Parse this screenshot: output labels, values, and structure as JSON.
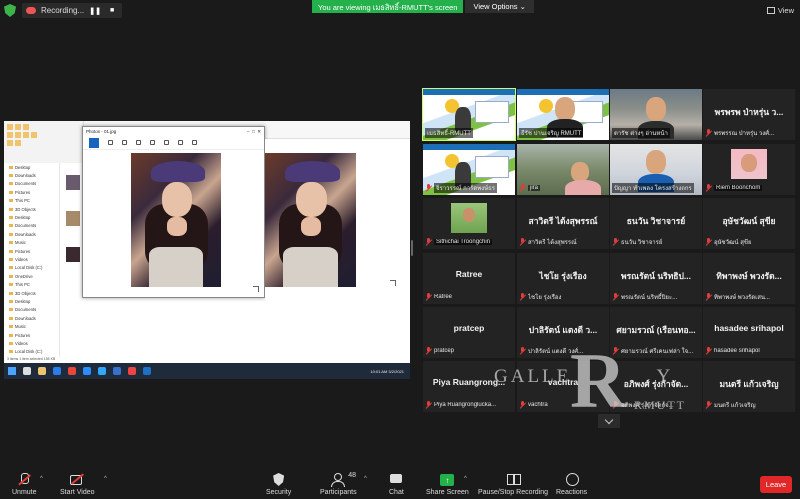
{
  "top": {
    "recording_label": "Recording...",
    "viewing_banner": "You are viewing เมธสิทธิ์-RMUTT's screen",
    "view_options": "View Options",
    "view_label": "View"
  },
  "shared_screen": {
    "photos_title": "Photos - 01.jpg",
    "tree_items": [
      "Desktop",
      "Downloads",
      "Documents",
      "Pictures",
      "This PC",
      "3D Objects",
      "Desktop",
      "Documents",
      "Downloads",
      "Music",
      "Pictures",
      "Videos",
      "Local Disk (C:)",
      "OneDrive",
      "This PC",
      "3D Objects",
      "Desktop",
      "Documents",
      "Downloads",
      "Music",
      "Pictures",
      "Videos",
      "Local Disk (C:)",
      "Local Disk (D:)"
    ],
    "status_text": "3 items   1 item selected  155 KB",
    "clock": "10:01 AM 3/2/2021"
  },
  "gallery": {
    "participants": [
      {
        "name": "เมธสิทธิ์-RMUTT",
        "big": "",
        "video": "poster",
        "speaking": true,
        "muted": false
      },
      {
        "name": "ธีรัช ปานเจริญ RMUTT",
        "big": "",
        "video": "poster-person",
        "muted": false
      },
      {
        "name": "ดารัช ต่างๆ อ่านหน้า",
        "big": "",
        "video": "room-person",
        "muted": false
      },
      {
        "name": "พรพรรณ ป่าหรุ่น วงศ์...",
        "big": "พรพรพ ป่าหรุ่น ว...",
        "video": "none",
        "muted": true
      },
      {
        "name": "จิราวรรณ์ การ์ดพงษ์ธร",
        "big": "",
        "video": "poster",
        "muted": true
      },
      {
        "name": "jira",
        "big": "",
        "video": "room2",
        "muted": true
      },
      {
        "name": "ปัญญา ทำเพลง โครงสร้างถกร",
        "big": "",
        "video": "room3",
        "muted": false
      },
      {
        "name": "Riem Boonchom",
        "big": "",
        "video": "thumb-pink",
        "muted": true
      },
      {
        "name": "Sithichai Troongchin",
        "big": "",
        "video": "thumb-green",
        "muted": true
      },
      {
        "name": "สาวิตรี ได้งสุพรรณ์",
        "big": "สาวิตรี ได้งสุพรรณ์",
        "video": "none",
        "muted": true
      },
      {
        "name": "ธนวัน วิชาจารย์",
        "big": "ธนวัน วิชาจารย์",
        "video": "none",
        "muted": true
      },
      {
        "name": "อุษัชวัฒน์ สุขีย",
        "big": "อุษัชวัฒน์ สุขีย",
        "video": "none",
        "muted": true
      },
      {
        "name": "Ratree",
        "big": "Ratree",
        "video": "none",
        "muted": true
      },
      {
        "name": "ไชโย รุ่งเรือง",
        "big": "ไชโย รุ่งเรือง",
        "video": "none",
        "muted": true
      },
      {
        "name": "พรณรัตน์ นริทธิ์ปิยะ...",
        "big": "พรณรัตน์ นริทธิป...",
        "video": "none",
        "muted": true
      },
      {
        "name": "ทิพาพงษ์ พวงรัดเสน...",
        "big": "ทิพาพงษ์ พวงรัด...",
        "video": "none",
        "muted": true
      },
      {
        "name": "pratcep",
        "big": "pratcep",
        "video": "none",
        "muted": true
      },
      {
        "name": "ปาลิรัตน์ แตงดี วงศ์...",
        "big": "ปาลิรัตน์ แตงดี ว...",
        "video": "none",
        "muted": true
      },
      {
        "name": "ศยามรวณ์ ศรีเคนเฟล่า ใจ...",
        "big": "ศยามรวณ์ (เรือนทอ...",
        "video": "none",
        "muted": true
      },
      {
        "name": "hasadee srihapol",
        "big": "hasadee srihapol",
        "video": "none",
        "muted": true
      },
      {
        "name": "Piya Ruangronglucka...",
        "big": "Piya Ruangrong...",
        "video": "none",
        "muted": true
      },
      {
        "name": "vachtra",
        "big": "vachtra",
        "video": "none",
        "muted": true
      },
      {
        "name": "อภิพงศ์ รุ่งก้าจัดกัจ...",
        "big": "อภิพงศ์ รุ่งก้าจัด...",
        "video": "none",
        "muted": true
      },
      {
        "name": "มนตรี แก้วเจริญ",
        "big": "มนตรี แก้วเจริญ",
        "video": "none",
        "muted": true
      }
    ]
  },
  "watermark": {
    "gallery": "GALLE",
    "letter": "R",
    "gallery2": "Y",
    "mutt": "RMUTT"
  },
  "toolbar": {
    "unmute": "Unmute",
    "start_video": "Start Video",
    "security": "Security",
    "participants": "Participants",
    "participants_count": "48",
    "chat": "Chat",
    "share_screen": "Share Screen",
    "recording": "Pause/Stop Recording",
    "reactions": "Reactions",
    "leave": "Leave"
  }
}
